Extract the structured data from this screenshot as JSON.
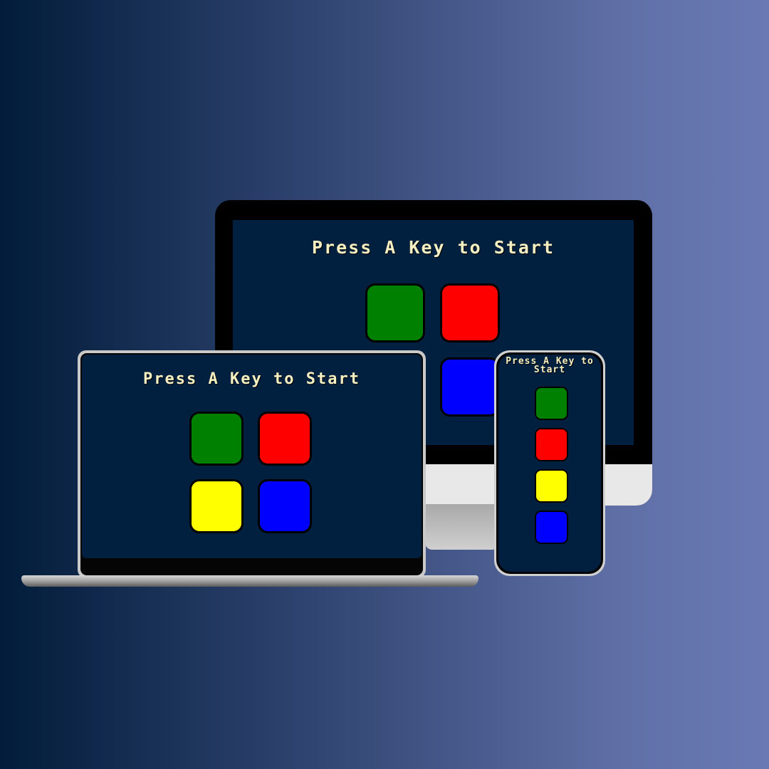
{
  "game": {
    "start_prompt": "Press A Key to Start"
  },
  "colors": {
    "background_start": "#021c3a",
    "background_end": "#6a79b3",
    "game_screen": "#01203f",
    "title_text": "#f6efc1",
    "green": "#008000",
    "red": "#ff0000",
    "yellow": "#ffff00",
    "blue": "#0000ff"
  },
  "pads": [
    "green",
    "red",
    "yellow",
    "blue"
  ]
}
